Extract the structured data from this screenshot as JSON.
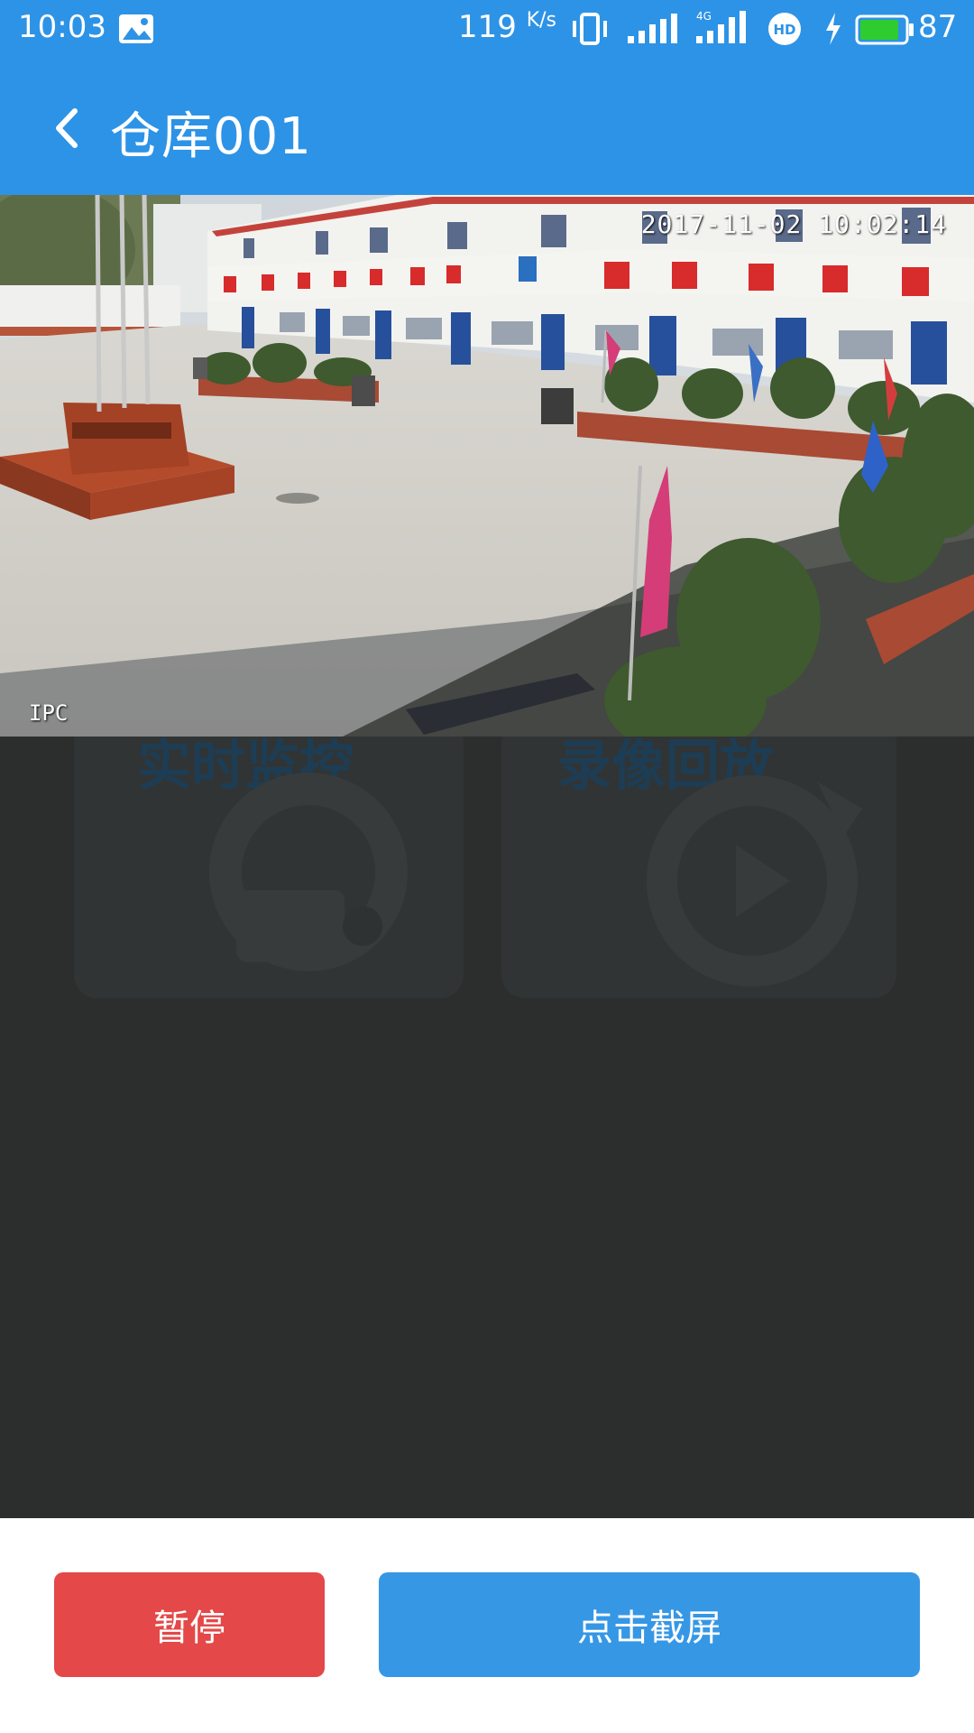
{
  "status_bar": {
    "time": "10:03",
    "net_speed": "119",
    "net_speed_unit": "K/s",
    "signal_tag": "4G",
    "hd_label": "HD",
    "battery_percent": "87",
    "battery_level": 0.87
  },
  "header": {
    "title": "仓库001",
    "back_icon": "chevron-left-icon"
  },
  "video": {
    "timestamp": "2017-11-02 10:02:14",
    "camera_tag": "IPC"
  },
  "backdrop_menu": {
    "live_label": "实时监控",
    "playback_label": "录像回放"
  },
  "actions": {
    "pause_label": "暂停",
    "screenshot_label": "点击截屏"
  },
  "colors": {
    "primary": "#2d93e6",
    "danger": "#e44848",
    "button_blue": "#3697e5",
    "overlay": "#2c2e2e"
  }
}
